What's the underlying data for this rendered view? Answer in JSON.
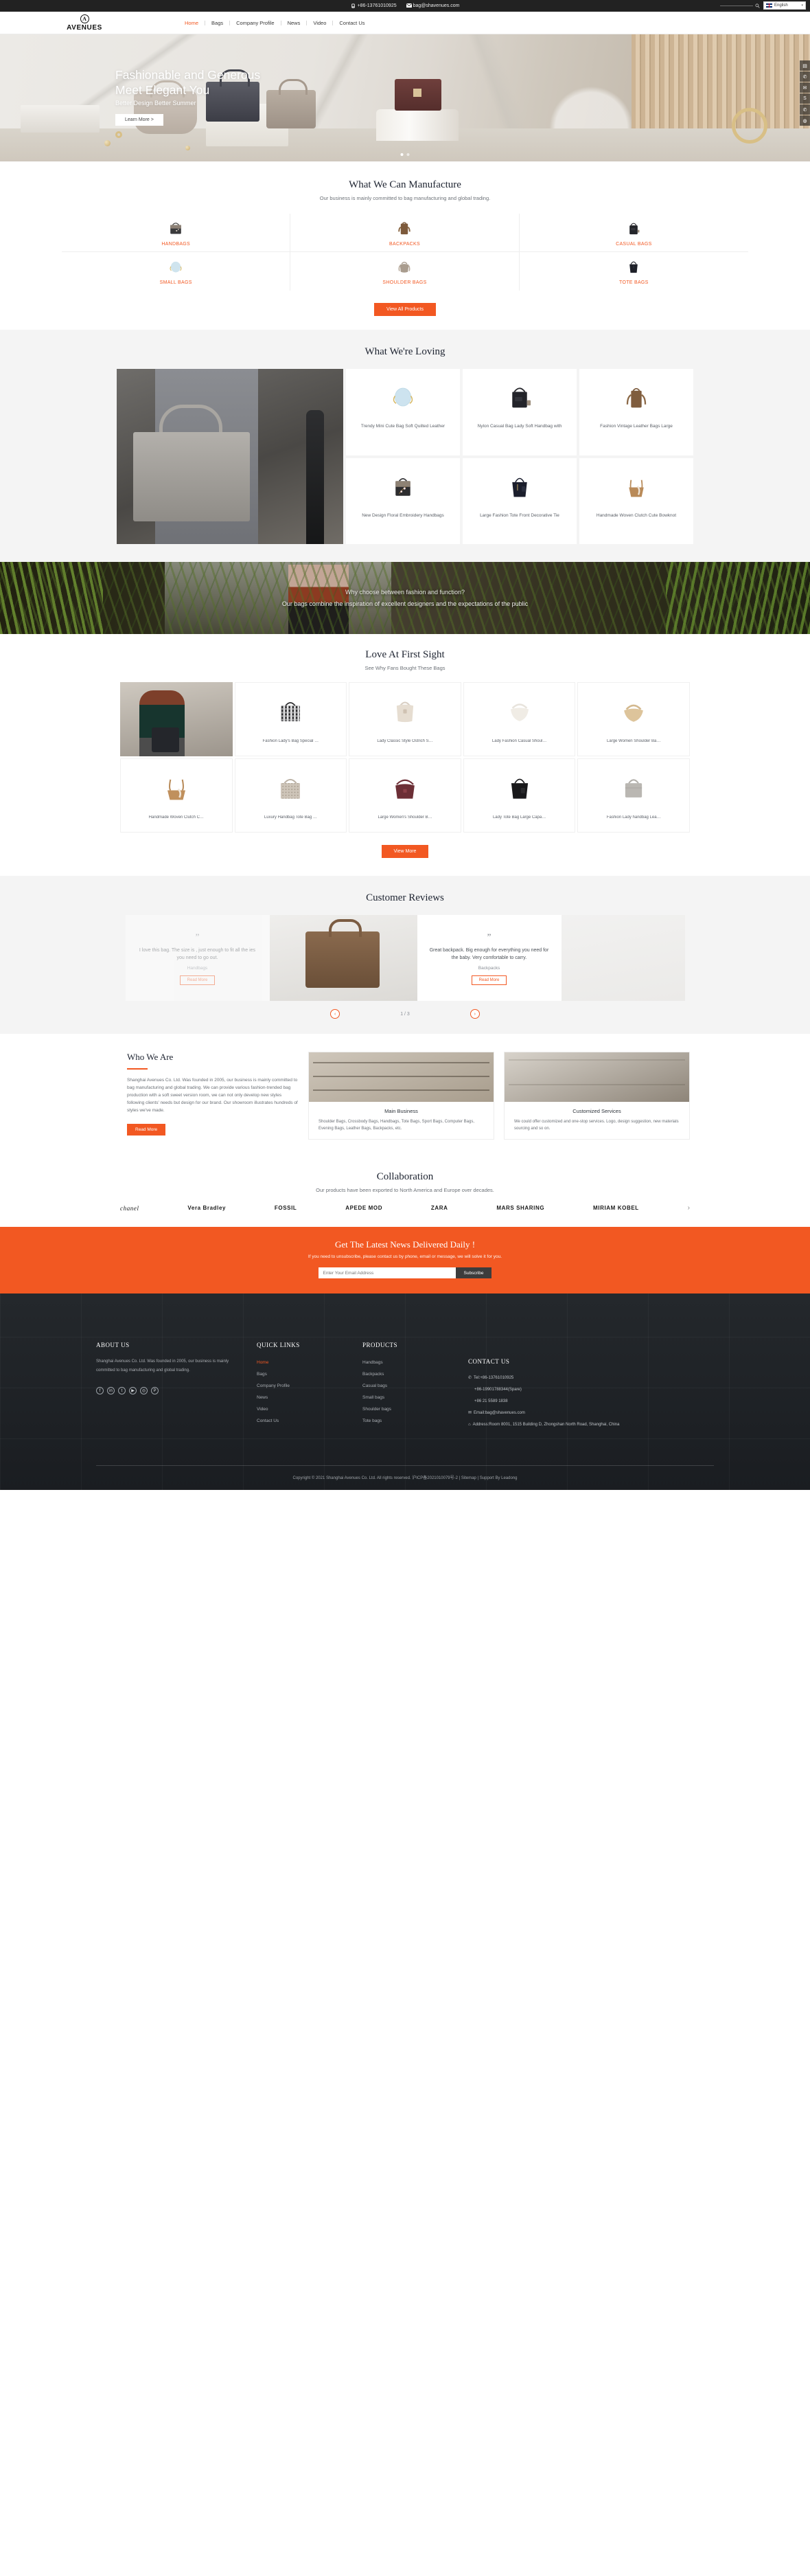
{
  "topbar": {
    "phone": "+86-13761010925",
    "email": "bag@shavenues.com",
    "phone_icon": "phone-icon",
    "email_icon": "envelope-icon",
    "search_icon": "search-icon",
    "language": "English",
    "language_caret": "▾"
  },
  "header": {
    "logo_mark": "A",
    "logo_text": "AVENUES",
    "nav": [
      {
        "label": "Home",
        "active": true
      },
      {
        "label": "Bags",
        "active": false
      },
      {
        "label": "Company Profile",
        "active": false
      },
      {
        "label": "News",
        "active": false
      },
      {
        "label": "Video",
        "active": false
      },
      {
        "label": "Contact Us",
        "active": false
      }
    ]
  },
  "hero": {
    "title_line1": "Fashionable and Generous",
    "title_line2": "Meet Elegant You",
    "subtitle": "Better Design Better Summer",
    "button": "Learn More >",
    "dots": 2,
    "active_dot": 1,
    "side_tools": [
      "qr-icon",
      "phone-icon",
      "envelope-icon",
      "skype-icon",
      "whatsapp-icon",
      "wechat-icon"
    ]
  },
  "manufacture": {
    "title": "What We Can Manufacture",
    "subtitle": "Our business is mainly committed to bag manufacturing and global trading.",
    "categories": [
      {
        "label": "HANDBAGS",
        "icon": "handbag-icon"
      },
      {
        "label": "BACKPACKS",
        "icon": "backpack-icon"
      },
      {
        "label": "CASUAL BAGS",
        "icon": "casual-bag-icon"
      },
      {
        "label": "SMALL BAGS",
        "icon": "small-bag-icon"
      },
      {
        "label": "SHOULDER BAGS",
        "icon": "shoulder-bag-icon"
      },
      {
        "label": "TOTE BAGS",
        "icon": "tote-bag-icon"
      }
    ],
    "view_all": "View All Products"
  },
  "loving": {
    "title": "What We're Loving",
    "items": [
      {
        "title": "Trendy Mini Cute Bag Soft Quilted Leather"
      },
      {
        "title": "Nylon Casual Bag Lady Soft Handbag with"
      },
      {
        "title": "Fashion Vintage Leather Bags Large"
      },
      {
        "title": "New Design Floral Embroidery Handbags"
      },
      {
        "title": "Large Fashion Tote Front Decorative Tie"
      },
      {
        "title": "Handmade Woven Clutch Cute Bowknot"
      }
    ]
  },
  "banner": {
    "line1": "Why choose between fashion and function?",
    "line2": "Our bags combine the inspiration of excellent designers and the expectations of the public"
  },
  "lafs": {
    "title": "Love At First Sight",
    "subtitle": "See Why Fans Bought These Bags",
    "row1": [
      {
        "title": "Fashion Lady's Bag Special …"
      },
      {
        "title": "Lady Classic Style Ostrich S…"
      },
      {
        "title": "Lady Fashion Casual Shoul…"
      },
      {
        "title": "Large Women Shoulder Ba…"
      }
    ],
    "row2": [
      {
        "title": "Handmade Woven Clutch C…"
      },
      {
        "title": "Luxury Handbag Tote Bag …"
      },
      {
        "title": "Large Women's Shoulder B…"
      },
      {
        "title": "Lady Tote Bag Large Capa…"
      },
      {
        "title": "Fashion Lady handbag Lea…"
      }
    ],
    "view_more": "View More"
  },
  "reviews": {
    "title": "Customer Reviews",
    "left_card": {
      "quote": "”",
      "text": "I love this bag. The size is  , just enough to fit all the ies you need to go out.",
      "name": "Handbags",
      "button": "Read More"
    },
    "right_card": {
      "quote": "”",
      "text": "Great backpack. Big enough for everything you need for the baby. Very comfortable to carry.",
      "name": "Backpacks",
      "button": "Read More"
    },
    "counter": "1 / 3",
    "prev_icon": "‹",
    "next_icon": "›"
  },
  "who": {
    "title": "Who We Are",
    "paragraph": "Shanghai Avenues Co. Ltd. Was founded in 2005, our business is mainly committed to bag manufacturing and global trading. We can provide various fashion-trended bag production with a soft sweet version room, we can not only develop new styles following clients' needs but design for our brand. Our showroom illustrates hundreds of styles we've made.",
    "button": "Read More",
    "cards": [
      {
        "heading": "Main Business",
        "text": "Shoulder Bags, Crossbody Bags, Handbags, Tote Bags, Sport Bags, Computer Bags, Evening Bags, Leather Bags, Backpacks, etc."
      },
      {
        "heading": "Customized Services",
        "text": "We could offer customized and one-stop services. Logo, design suggestion, new materials sourcing and so on."
      }
    ]
  },
  "collab": {
    "title": "Collaboration",
    "subtitle": "Our products have been exported to North America and Europe over decades.",
    "brands": [
      {
        "name": "chanel"
      },
      {
        "name": "Vera Bradley"
      },
      {
        "name": "FOSSIL"
      },
      {
        "name": "APEDE MOD"
      },
      {
        "name": "ZARA"
      },
      {
        "name": "MARS SHARING"
      },
      {
        "name": "MIRIAM KOBEL"
      }
    ],
    "next_arrow": "›"
  },
  "newsletter": {
    "heading": "Get The Latest News Delivered Daily !",
    "paragraph": "If you need to unsubscribe, please contact us by phone, email or message, we will solve it for you.",
    "placeholder": "Enter Your Email Address",
    "button": "Subscribe"
  },
  "footer": {
    "about": {
      "heading": "ABOUT US",
      "text": "Shanghai Avenues Co. Ltd. Was founded in 2005, our business is mainly committed to bag manufacturing and global trading.",
      "socials": [
        "facebook-icon",
        "linkedin-icon",
        "twitter-icon",
        "youtube-icon",
        "instagram-icon",
        "pinterest-icon"
      ]
    },
    "quick_links": {
      "heading": "QUICK LINKS",
      "items": [
        {
          "label": "Home",
          "active": true
        },
        {
          "label": "Bags",
          "active": false
        },
        {
          "label": "Company Profile",
          "active": false
        },
        {
          "label": "News",
          "active": false
        },
        {
          "label": "Video",
          "active": false
        },
        {
          "label": "Contact Us",
          "active": false
        }
      ]
    },
    "products": {
      "heading": "PRODUCTS",
      "items": [
        "Handbags",
        "Backpacks",
        "Casual bags",
        "Small bags",
        "Shoulder bags",
        "Tote bags"
      ]
    },
    "contact": {
      "heading": "CONTACT US",
      "tel_icon": "phone-icon",
      "tel1": "Tel:+86-13761010925",
      "tel2": "+86-19901788344(Spare)",
      "tel3": "+86 21 5589 1838",
      "email_icon": "envelope-icon",
      "email": "Email:bag@shavenues.com",
      "address_icon": "location-icon",
      "address": "Address:Room 8001, 1515 Building D, Zhongshan North Road, Shanghai, China"
    },
    "copyright": "Copyright © 2021 Shanghai Avenues Co. Ltd. All rights reserved.  沪ICP备2021010079号-2 | Sitemap | Support By Leadong"
  }
}
